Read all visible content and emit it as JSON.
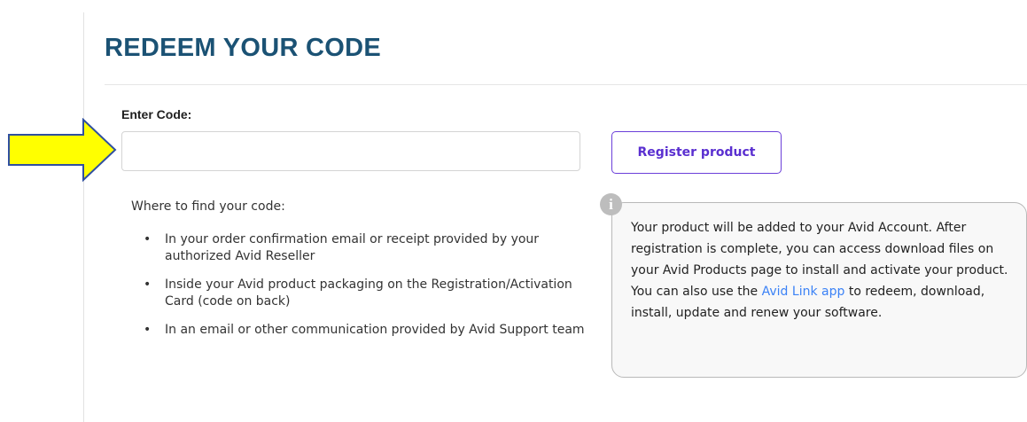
{
  "page": {
    "title": "REDEEM YOUR CODE"
  },
  "form": {
    "code_label": "Enter Code:",
    "code_value": "",
    "code_placeholder": "",
    "register_label": "Register product"
  },
  "find": {
    "heading": "Where to find your code:",
    "items": [
      "In your order confirmation email or receipt provided by your authorized Avid Reseller",
      "Inside your Avid product packaging on the Registration/Activation Card (code on back)",
      "In an email or other communication provided by Avid Support team"
    ]
  },
  "info": {
    "icon_glyph": "i",
    "text_before": "Your product will be added to your Avid Account. After registration is complete, you can access download files on your Avid Products page to install and activate your product. You can also use the ",
    "link_text": "Avid Link app",
    "text_after": " to redeem, download, install, update and renew your software."
  },
  "colors": {
    "title": "#1b5274",
    "button_accent": "#6b3fd9",
    "link": "#3b82f6",
    "arrow_fill": "#ffff00",
    "arrow_stroke": "#2f4fa0"
  },
  "icons": {
    "info": "info-icon",
    "pointer_arrow": "arrow-right-icon"
  }
}
